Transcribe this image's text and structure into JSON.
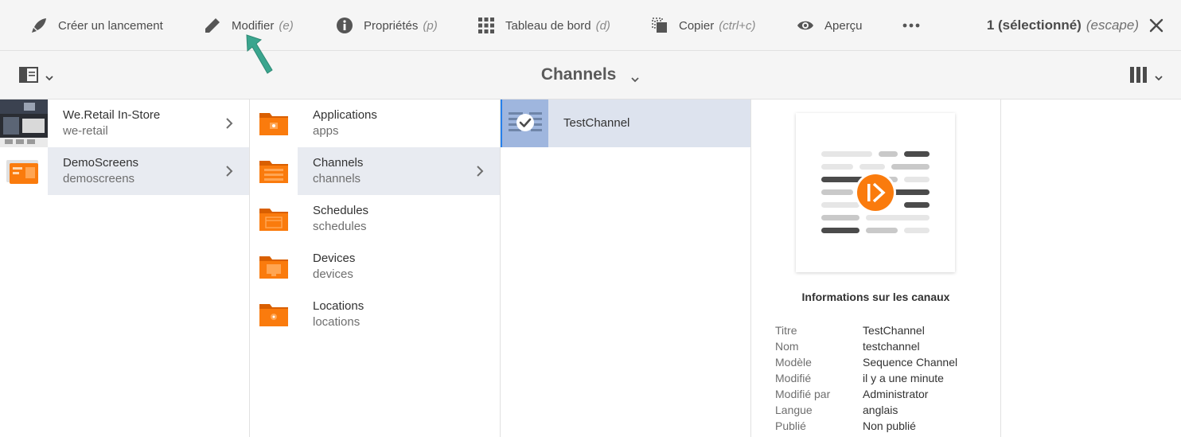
{
  "actionbar": {
    "create_launch": {
      "label": "Créer un lancement",
      "icon": "rocket-icon"
    },
    "edit": {
      "label": "Modifier",
      "shortcut": "(e)",
      "icon": "pencil-icon"
    },
    "properties": {
      "label": "Propriétés",
      "shortcut": "(p)",
      "icon": "info-icon"
    },
    "dashboard": {
      "label": "Tableau de bord",
      "shortcut": "(d)",
      "icon": "grid-icon"
    },
    "copy": {
      "label": "Copier",
      "shortcut": "(ctrl+c)",
      "icon": "copy-icon"
    },
    "preview": {
      "label": "Aperçu",
      "icon": "eye-icon"
    },
    "more": {
      "icon": "more-icon"
    },
    "selection": {
      "label": "1 (sélectionné)",
      "shortcut": "(escape)"
    }
  },
  "titlebar": {
    "title": "Channels"
  },
  "columns": {
    "col1": [
      {
        "title": "We.Retail In-Store",
        "sub": "we-retail"
      },
      {
        "title": "DemoScreens",
        "sub": "demoscreens"
      }
    ],
    "col2": [
      {
        "title": "Applications",
        "sub": "apps"
      },
      {
        "title": "Channels",
        "sub": "channels"
      },
      {
        "title": "Schedules",
        "sub": "schedules"
      },
      {
        "title": "Devices",
        "sub": "devices"
      },
      {
        "title": "Locations",
        "sub": "locations"
      }
    ],
    "col3": [
      {
        "title": "TestChannel"
      }
    ]
  },
  "preview": {
    "heading": "Informations sur les canaux",
    "meta": [
      {
        "key": "Titre",
        "value": "TestChannel"
      },
      {
        "key": "Nom",
        "value": "testchannel"
      },
      {
        "key": "Modèle",
        "value": "Sequence Channel"
      },
      {
        "key": "Modifié",
        "value": "il y a une minute"
      },
      {
        "key": "Modifié par",
        "value": "Administrator"
      },
      {
        "key": "Langue",
        "value": "anglais"
      },
      {
        "key": "Publié",
        "value": "Non publié"
      }
    ]
  },
  "colors": {
    "folder_orange": "#fa7b0d",
    "accent_blue": "#2680eb",
    "cursor_teal": "#3aa58e"
  }
}
